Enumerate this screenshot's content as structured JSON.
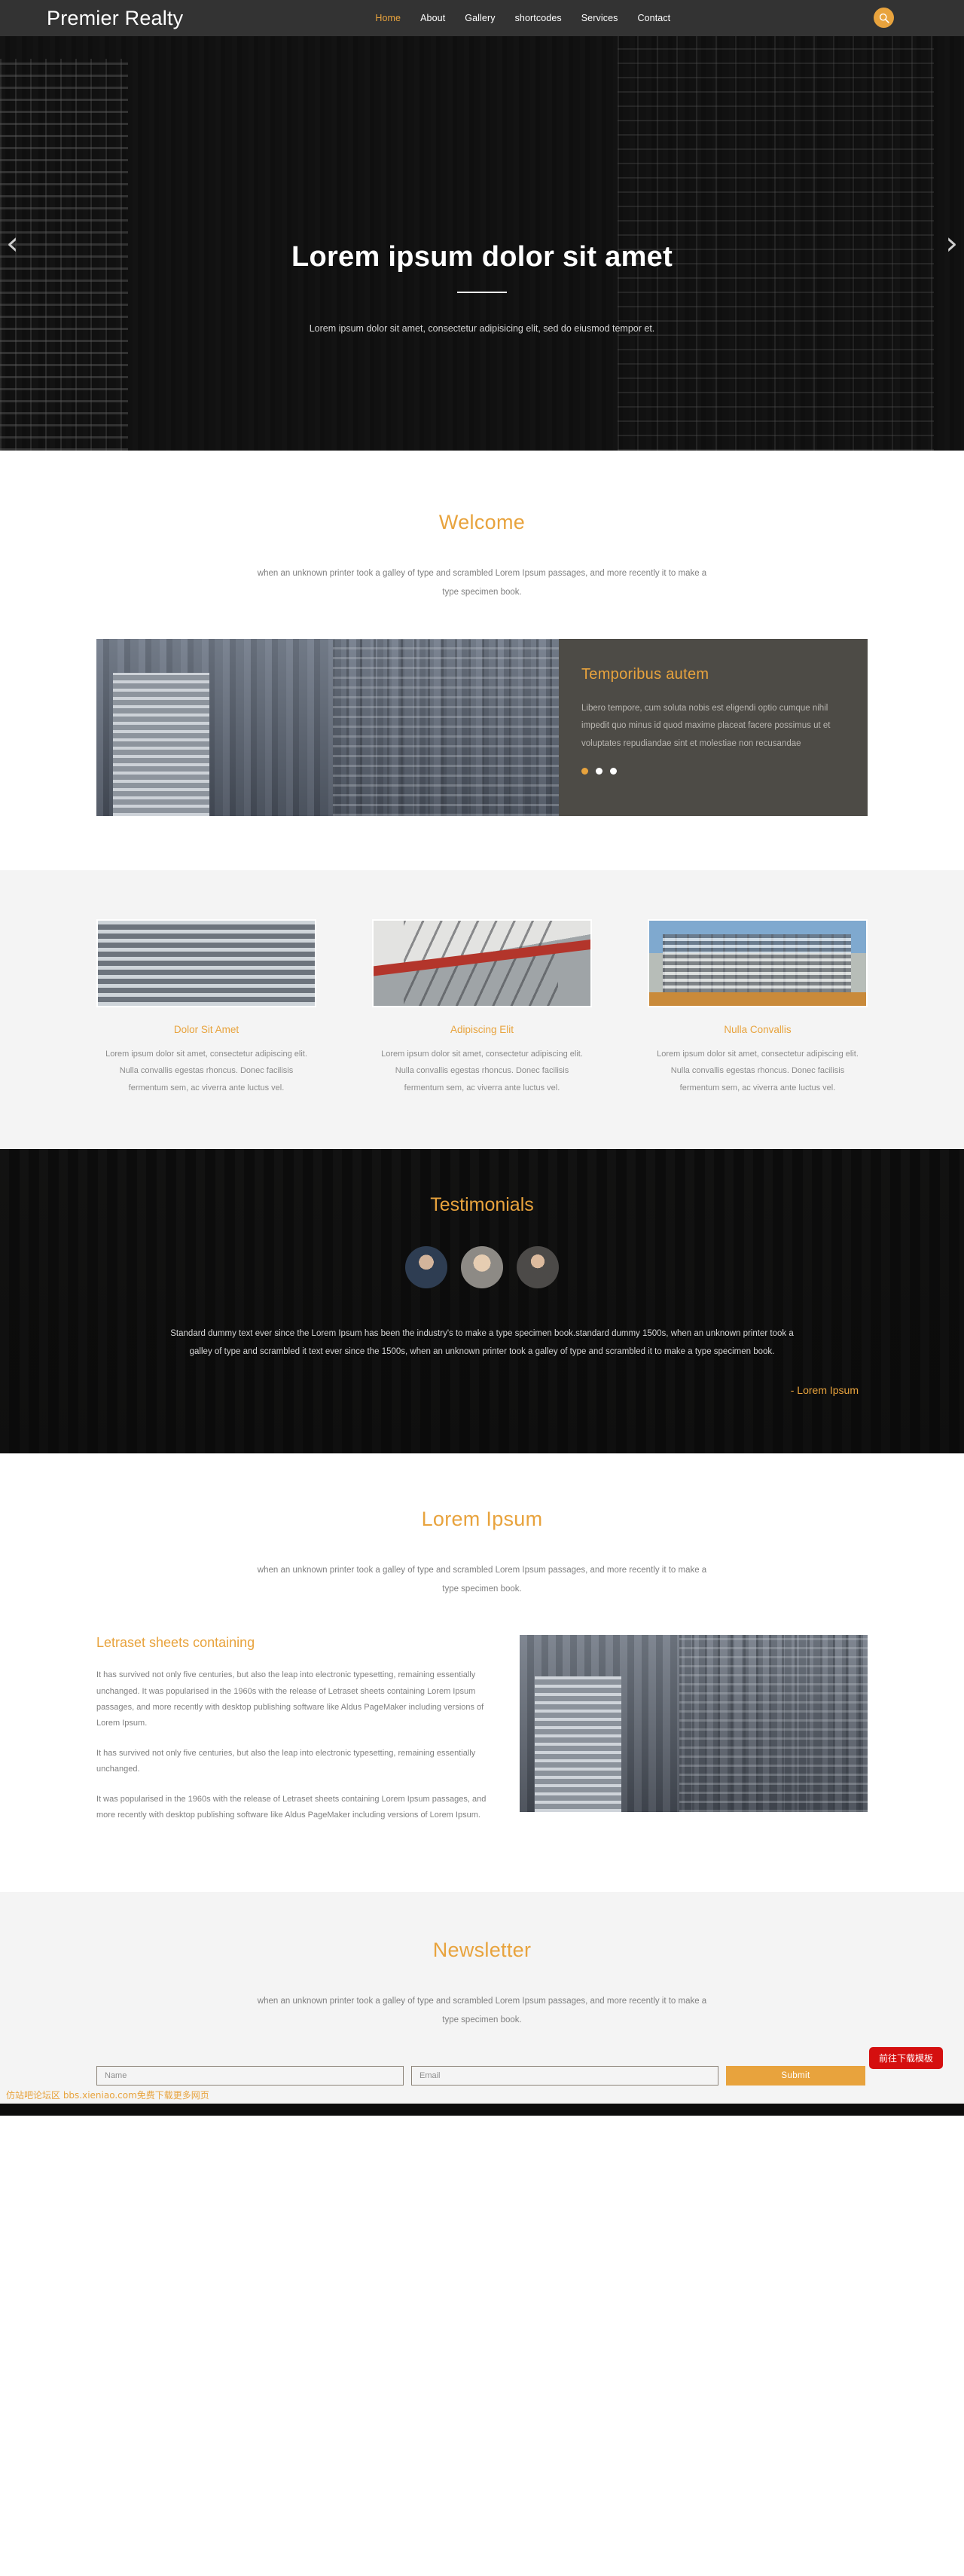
{
  "header": {
    "brand": "Premier Realty",
    "nav": [
      {
        "label": "Home",
        "active": true
      },
      {
        "label": "About",
        "active": false
      },
      {
        "label": "Gallery",
        "active": false
      },
      {
        "label": "shortcodes",
        "active": false
      },
      {
        "label": "Services",
        "active": false
      },
      {
        "label": "Contact",
        "active": false
      }
    ],
    "search_icon": "search-icon",
    "accent_color": "#e8a33d",
    "bar_color": "#333333"
  },
  "hero": {
    "title": "Lorem ipsum dolor sit amet",
    "subtitle": "Lorem ipsum dolor sit amet, consectetur adipisicing elit, sed do eiusmod tempor et.",
    "prev_icon": "‹",
    "next_icon": "›"
  },
  "welcome": {
    "title": "Welcome",
    "lead": "when an unknown printer took a galley of type and scrambled Lorem Ipsum passages, and more recently it to make a type specimen book."
  },
  "panel": {
    "title": "Temporibus autem",
    "text": "Libero tempore, cum soluta nobis est eligendi optio cumque nihil impedit quo minus id quod maxime placeat facere possimus ut et voluptates repudiandae sint et molestiae non recusandae",
    "dots": [
      true,
      false,
      false
    ]
  },
  "cards": [
    {
      "title": "Dolor Sit Amet",
      "text": "Lorem ipsum dolor sit amet, consectetur adipiscing elit. Nulla convallis egestas rhoncus. Donec facilisis fermentum sem, ac viverra ante luctus vel."
    },
    {
      "title": "Adipiscing Elit",
      "text": "Lorem ipsum dolor sit amet, consectetur adipiscing elit. Nulla convallis egestas rhoncus. Donec facilisis fermentum sem, ac viverra ante luctus vel."
    },
    {
      "title": "Nulla Convallis",
      "text": "Lorem ipsum dolor sit amet, consectetur adipiscing elit. Nulla convallis egestas rhoncus. Donec facilisis fermentum sem, ac viverra ante luctus vel."
    }
  ],
  "testimonials": {
    "title": "Testimonials",
    "avatars": [
      "avatar-man-beard",
      "avatar-woman-blonde",
      "avatar-woman-dark-hair"
    ],
    "quote": "Standard dummy text ever since the Lorem Ipsum has been the industry's to make a type specimen book.standard dummy 1500s, when an unknown printer took a galley of type and scrambled it text ever since the 1500s, when an unknown printer took a galley of type and scrambled it to make a type specimen book.",
    "author": "- Lorem Ipsum"
  },
  "lorem": {
    "title": "Lorem Ipsum",
    "lead": "when an unknown printer took a galley of type and scrambled Lorem Ipsum passages, and more recently it to make a type specimen book.",
    "letraset_title": "Letraset sheets containing",
    "paragraphs": [
      "It has survived not only five centuries, but also the leap into electronic typesetting, remaining essentially unchanged. It was popularised in the 1960s with the release of Letraset sheets containing Lorem Ipsum passages, and more recently with desktop publishing software like Aldus PageMaker including versions of Lorem Ipsum.",
      "It has survived not only five centuries, but also the leap into electronic typesetting, remaining essentially unchanged.",
      "It was popularised in the 1960s with the release of Letraset sheets containing Lorem Ipsum passages, and more recently with desktop publishing software like Aldus PageMaker including versions of Lorem Ipsum."
    ]
  },
  "newsletter": {
    "title": "Newsletter",
    "lead": "when an unknown printer took a galley of type and scrambled Lorem Ipsum passages, and more recently it to make a type specimen book.",
    "name_placeholder": "Name",
    "name_value": "",
    "email_placeholder": "Email",
    "email_value": "",
    "submit_label": "Submit",
    "download_badge": "前往下载模板",
    "watermark": "仿站吧论坛区 bbs.xieniao.com免费下载更多网页"
  }
}
